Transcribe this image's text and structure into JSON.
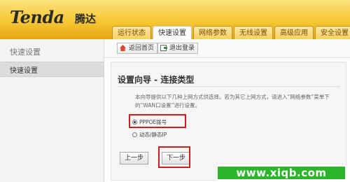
{
  "brand": {
    "logo_text": "Tenda",
    "logo_cn": "腾达"
  },
  "tabs": [
    {
      "label": "运行状态"
    },
    {
      "label": "快速设置",
      "active": true
    },
    {
      "label": "网络参数"
    },
    {
      "label": "无线设置"
    },
    {
      "label": "高级应用"
    },
    {
      "label": "安全设置"
    }
  ],
  "sidebar": {
    "title": "快速设置",
    "items": [
      {
        "label": "快速设置",
        "selected": true
      }
    ]
  },
  "toolbar": {
    "home_label": "返回首页",
    "logout_label": "退出登录"
  },
  "wizard": {
    "title": "设置向导 - 连接类型",
    "description": "本向导提供以下几种上网方式供选择。若为其它上网方式，请进入“网络参数”菜单下的“WAN口设置”进行设置。",
    "options": [
      {
        "label": "PPPOE拨号",
        "selected": true
      },
      {
        "label": "动态/静态IP",
        "selected": false
      }
    ],
    "prev_label": "上一步",
    "next_label": "下一步"
  },
  "watermark": "www.xiqb.com",
  "colors": {
    "header": "#f7c733",
    "highlight": "#d21b1b",
    "watermark_bg": "#2bb52b"
  }
}
